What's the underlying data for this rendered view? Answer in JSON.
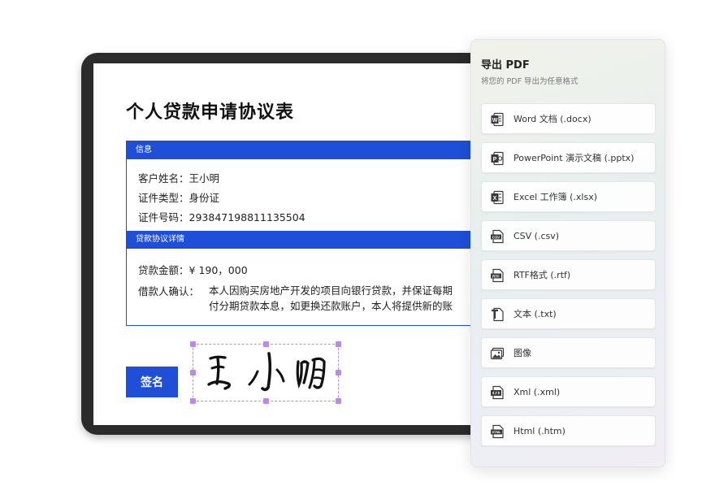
{
  "document": {
    "title": "个人贷款申请协议表",
    "section_info": "信息",
    "fields": [
      {
        "label": "客户姓名：",
        "value": "王小明"
      },
      {
        "label": "证件类型：",
        "value": "身份证"
      },
      {
        "label": "证件号码：",
        "value": "293847198811135504"
      }
    ],
    "section_loan": "贷款协议详情",
    "amount_label": "贷款金额：",
    "amount_value": "¥ 190，000",
    "confirm_label": "借款人确认：",
    "confirm_line1": "本人因购买房地产开发的项目向银行贷款，并保证每期",
    "confirm_line2": "付分期贷款本息，如更换还款账户，本人将提供新的账",
    "sign_button": "签名",
    "signature": "王小明"
  },
  "export_panel": {
    "title": "导出 PDF",
    "subtitle": "将您的 PDF 导出为任意格式",
    "options": [
      {
        "label": "Word 文档 (.docx)",
        "icon": "word-icon",
        "color": "#3a3a3a"
      },
      {
        "label": "PowerPoint 演示文稿 (.pptx)",
        "icon": "powerpoint-icon",
        "color": "#3a3a3a"
      },
      {
        "label": "Excel 工作簿 (.xlsx)",
        "icon": "excel-icon",
        "color": "#3a3a3a"
      },
      {
        "label": "CSV (.csv)",
        "icon": "csv-icon",
        "color": "#3a3a3a"
      },
      {
        "label": "RTF格式 (.rtf)",
        "icon": "rtf-icon",
        "color": "#3a3a3a"
      },
      {
        "label": "文本 (.txt)",
        "icon": "text-icon",
        "color": "#3a3a3a"
      },
      {
        "label": "图像",
        "icon": "image-icon",
        "color": "#3a3a3a"
      },
      {
        "label": "Xml (.xml)",
        "icon": "xml-icon",
        "color": "#3a3a3a"
      },
      {
        "label": "Html (.htm)",
        "icon": "html-icon",
        "color": "#3a3a3a"
      }
    ]
  },
  "colors": {
    "accent": "#1f4fd6",
    "selection": "#b98ae6",
    "device_frame": "#2b2b2b"
  }
}
